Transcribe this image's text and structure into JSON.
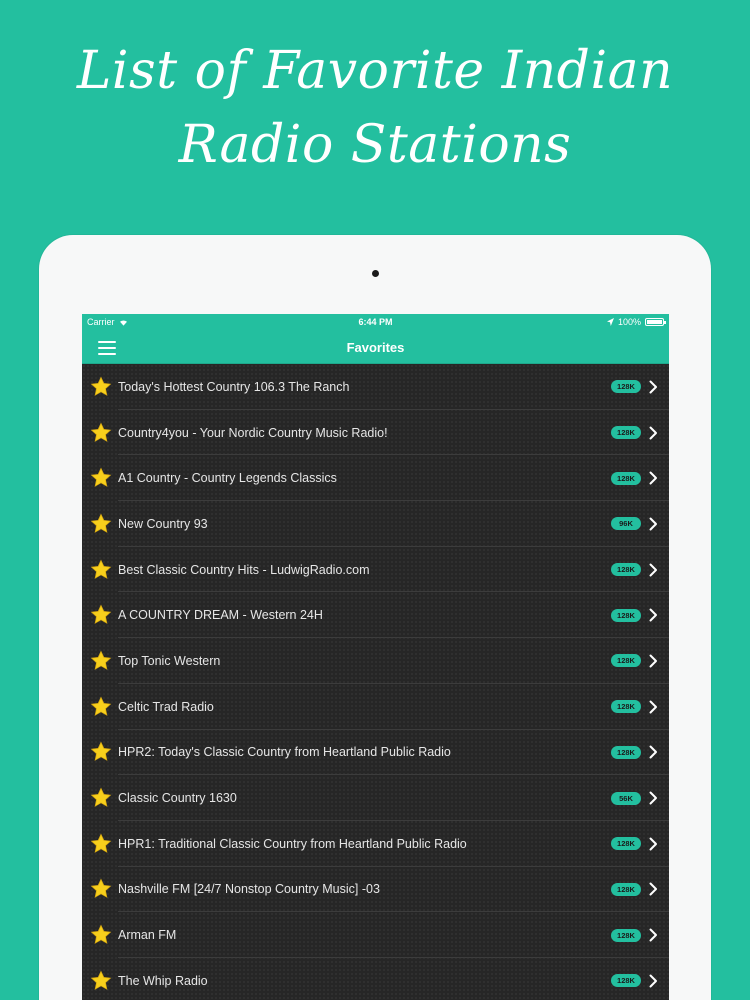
{
  "headline": {
    "line1": "List of Favorite Indian",
    "line2": "Radio Stations"
  },
  "statusbar": {
    "carrier": "Carrier",
    "time": "6:44 PM",
    "battery": "100%"
  },
  "navbar": {
    "title": "Favorites"
  },
  "colors": {
    "accent": "#23bf9f",
    "list_bg": "#262626",
    "star": "#f7cf1c"
  },
  "icons": {
    "menu": "hamburger-icon",
    "favorite": "star-icon",
    "row_action": "chevron-right-icon"
  },
  "stations": [
    {
      "name": "Today's Hottest Country 106.3 The Ranch",
      "bitrate": "128K"
    },
    {
      "name": "Country4you - Your Nordic Country Music Radio!",
      "bitrate": "128K"
    },
    {
      "name": "A1 Country - Country Legends Classics",
      "bitrate": "128K"
    },
    {
      "name": "New Country 93",
      "bitrate": "96K"
    },
    {
      "name": "Best Classic Country Hits - LudwigRadio.com",
      "bitrate": "128K"
    },
    {
      "name": "A COUNTRY DREAM - Western 24H",
      "bitrate": "128K"
    },
    {
      "name": "Top Tonic Western",
      "bitrate": "128K"
    },
    {
      "name": "Celtic Trad Radio",
      "bitrate": "128K"
    },
    {
      "name": "HPR2: Today's Classic Country from Heartland Public Radio",
      "bitrate": "128K"
    },
    {
      "name": "Classic Country 1630",
      "bitrate": "56K"
    },
    {
      "name": "HPR1: Traditional Classic Country from Heartland Public Radio",
      "bitrate": "128K"
    },
    {
      "name": "Nashville FM [24/7 Nonstop Country Music] -03",
      "bitrate": "128K"
    },
    {
      "name": "Arman FM",
      "bitrate": "128K"
    },
    {
      "name": "The Whip Radio",
      "bitrate": "128K"
    }
  ]
}
